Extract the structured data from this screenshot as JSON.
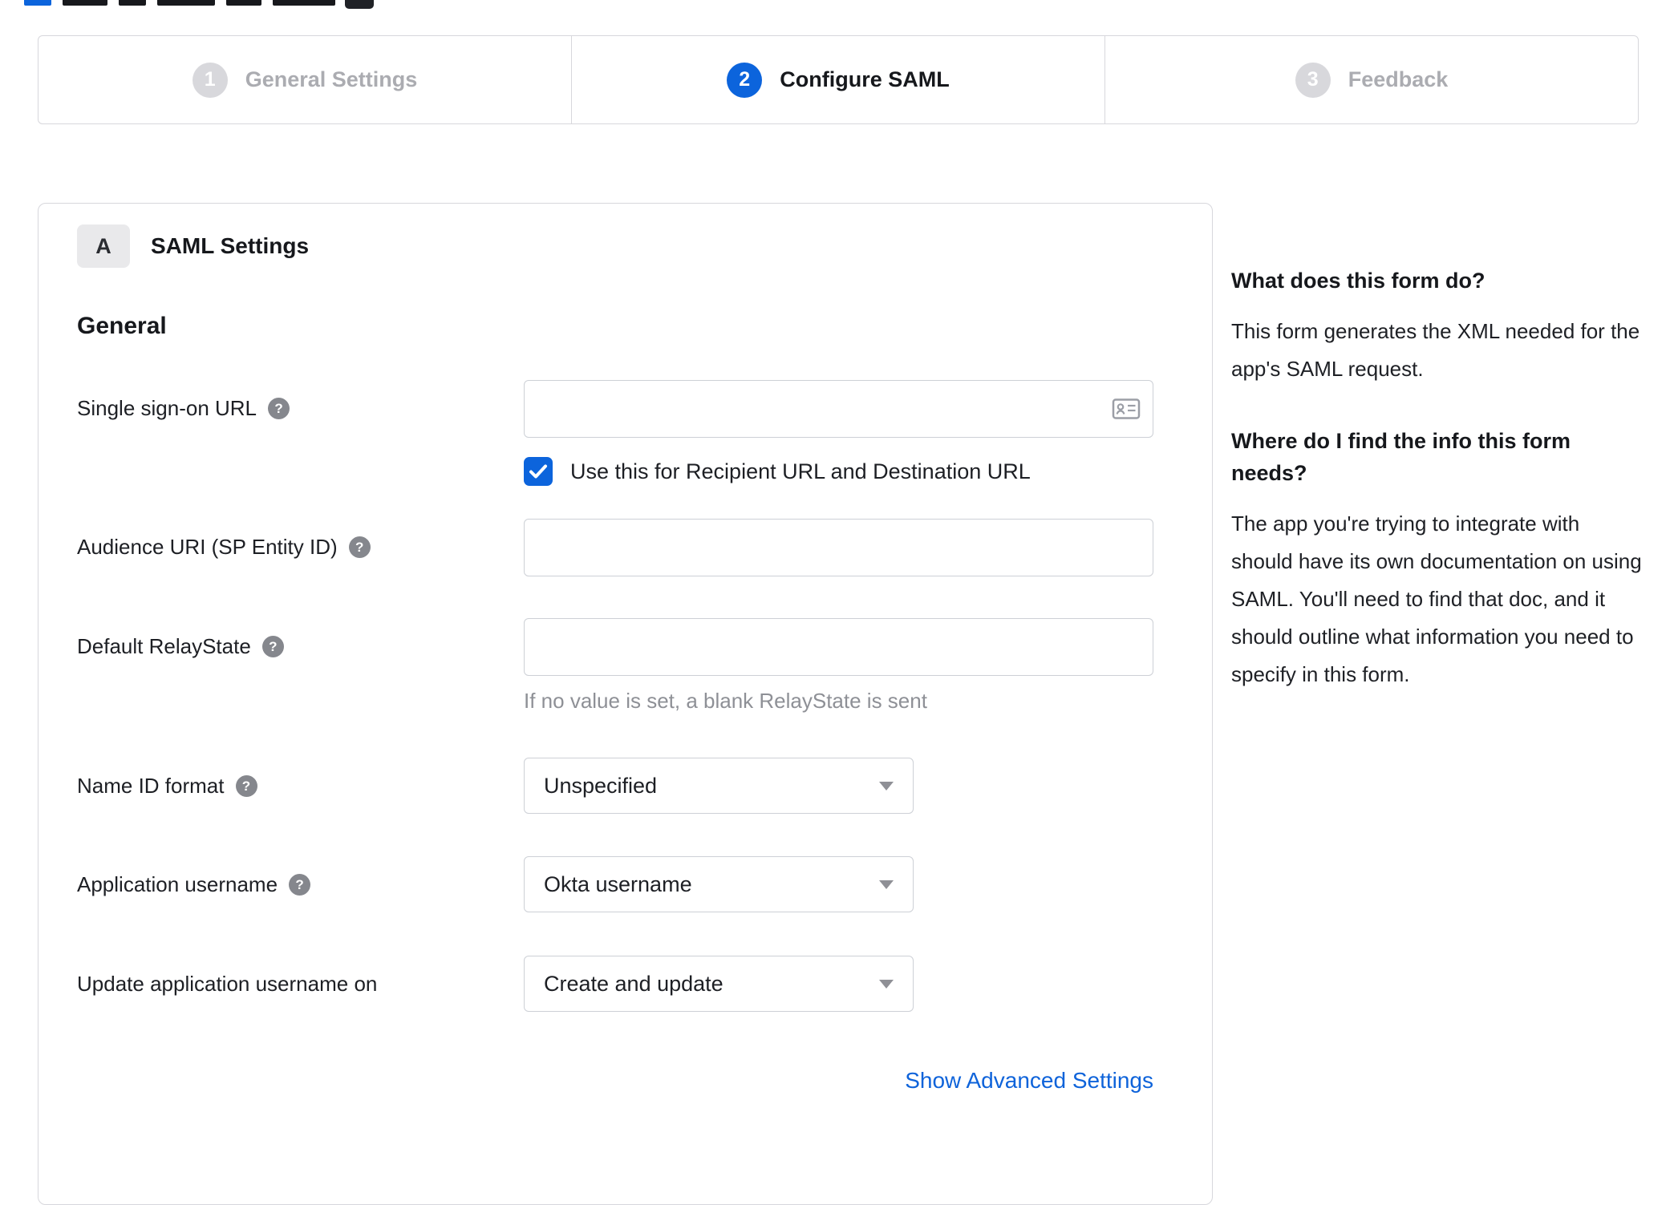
{
  "colors": {
    "accent_blue": "#0c64dc",
    "link_blue": "#0e63da",
    "step_inactive_gray": "#d8d8dc",
    "border_gray": "#d7d7dc",
    "hint_gray": "#8e9096"
  },
  "icons": {
    "help": "?",
    "checkmark": "✓",
    "dropdown_arrow": "triangle-down",
    "contact_card": "contact-card"
  },
  "stepper": {
    "steps": [
      {
        "number": "1",
        "label": "General Settings",
        "active": false
      },
      {
        "number": "2",
        "label": "Configure SAML",
        "active": true
      },
      {
        "number": "3",
        "label": "Feedback",
        "active": false
      }
    ]
  },
  "form": {
    "badge": "A",
    "title": "SAML Settings",
    "section_heading": "General",
    "sso_url": {
      "label": "Single sign-on URL",
      "value": ""
    },
    "sso_checkbox": {
      "label": "Use this for Recipient URL and Destination URL",
      "checked": true
    },
    "audience_uri": {
      "label": "Audience URI (SP Entity ID)",
      "value": ""
    },
    "relay_state": {
      "label": "Default RelayState",
      "value": "",
      "hint": "If no value is set, a blank RelayState is sent"
    },
    "name_id_format": {
      "label": "Name ID format",
      "value": "Unspecified"
    },
    "app_username": {
      "label": "Application username",
      "value": "Okta username"
    },
    "update_username": {
      "label": "Update application username on",
      "value": "Create and update"
    },
    "advanced_link": "Show Advanced Settings"
  },
  "help_panel": {
    "question_1": "What does this form do?",
    "answer_1": "This form generates the XML needed for the app's SAML request.",
    "question_2": "Where do I find the info this form needs?",
    "answer_2": "The app you're trying to integrate with should have its own documentation on using SAML. You'll need to find that doc, and it should outline what information you need to specify in this form."
  }
}
